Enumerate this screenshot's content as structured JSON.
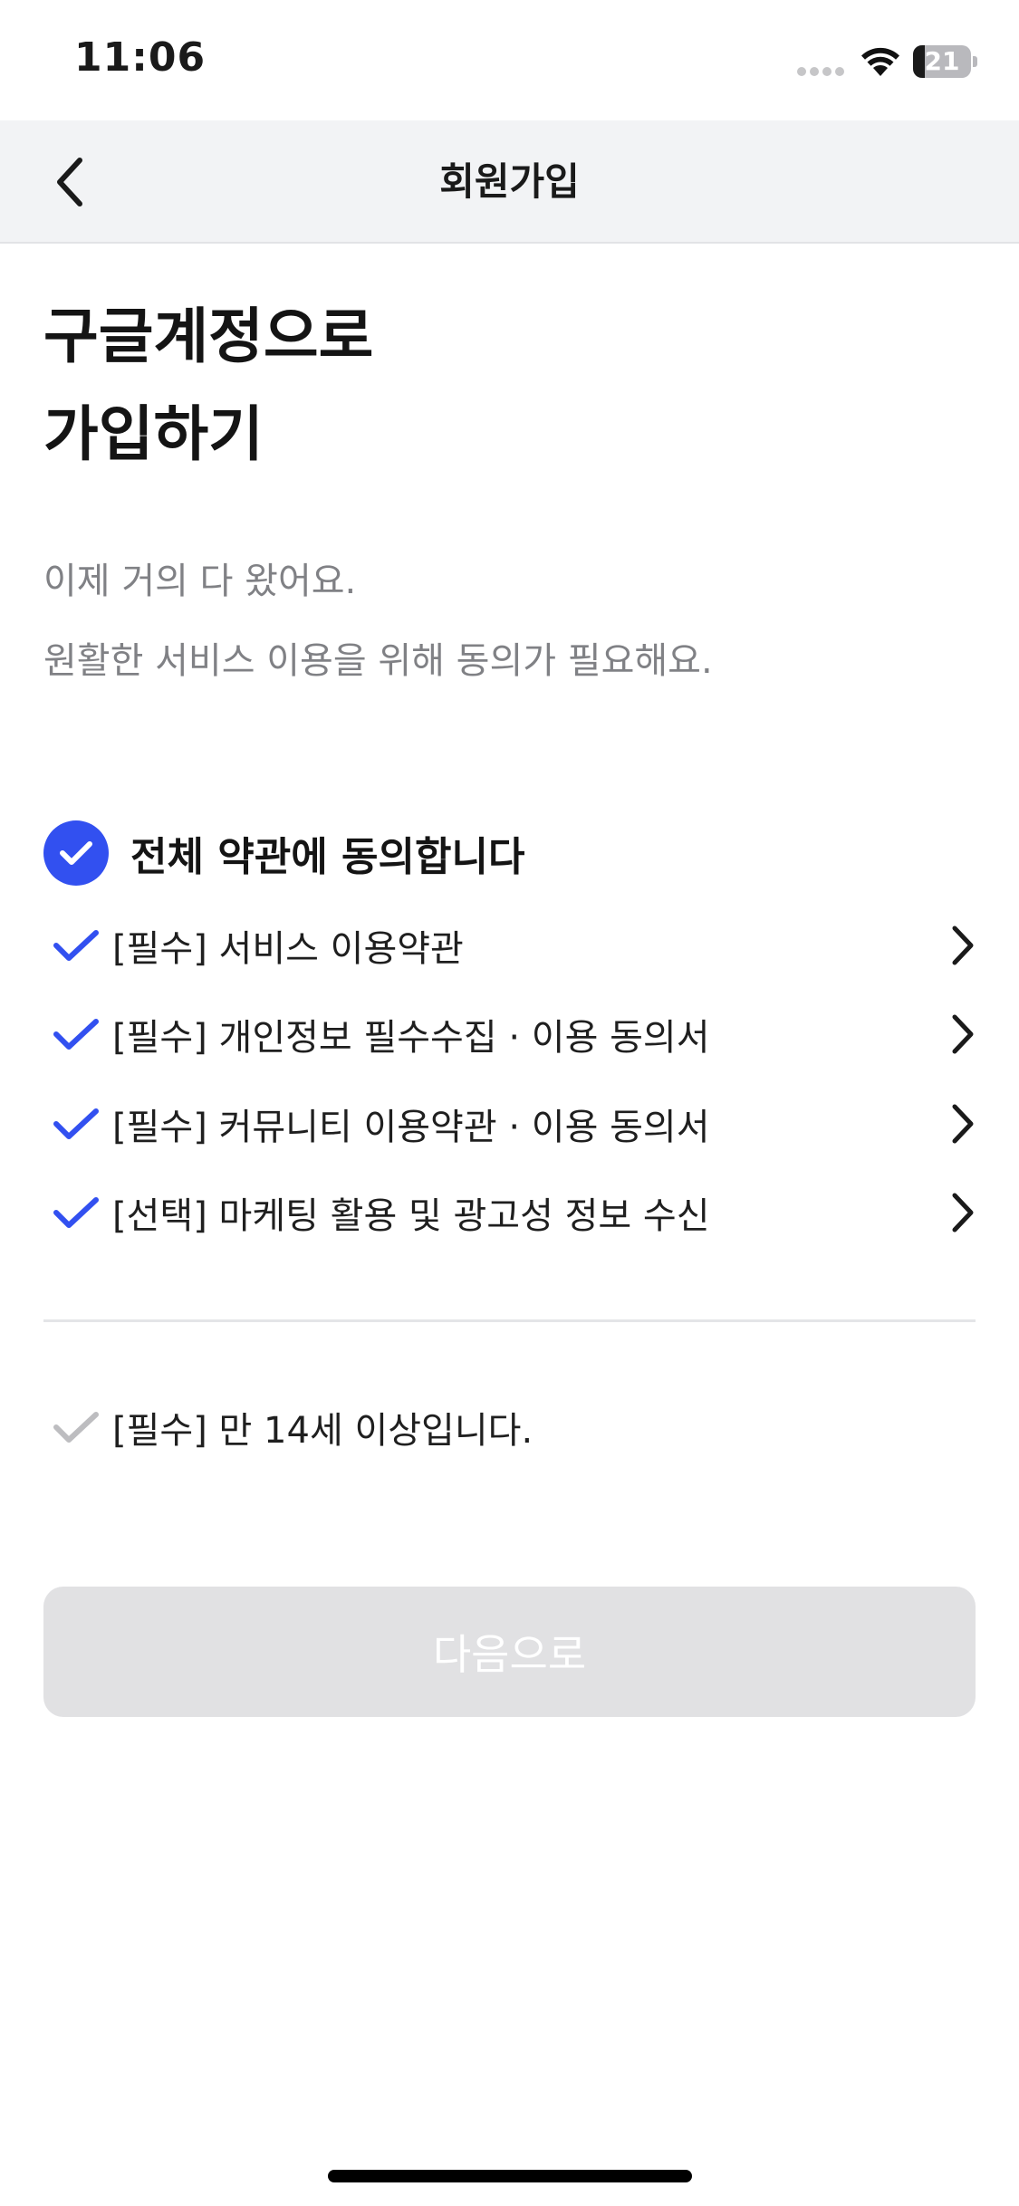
{
  "status_bar": {
    "time": "11:06",
    "battery_level": "21",
    "battery_fraction": 0.21,
    "icons": [
      "signal-dots-icon",
      "wifi-icon",
      "battery-icon"
    ]
  },
  "nav": {
    "title": "회원가입",
    "back_icon": "chevron-left-icon"
  },
  "headline": {
    "line1": "구글계정으로",
    "line2": "가입하기"
  },
  "subtext": {
    "line1": "이제 거의 다 왔어요.",
    "line2": "원활한 서비스 이용을 위해 동의가 필요해요."
  },
  "agreements": {
    "all_label": "전체 약관에 동의합니다",
    "all_checked": true,
    "items": [
      {
        "label": "[필수] 서비스 이용약관",
        "checked": true
      },
      {
        "label": "[필수] 개인정보 필수수집 · 이용 동의서",
        "checked": true
      },
      {
        "label": "[필수] 커뮤니티 이용약관 · 이용 동의서",
        "checked": true
      },
      {
        "label": "[선택] 마케팅 활용 및 광고성 정보 수신",
        "checked": true
      }
    ],
    "age": {
      "label": "[필수] 만 14세 이상입니다.",
      "checked": false
    }
  },
  "next_button": {
    "label": "다음으로",
    "enabled": false
  },
  "colors": {
    "accent": "#3250f0",
    "check_inactive": "#bdbdc0",
    "button_disabled": "#e1e1e3",
    "subtext": "#808185",
    "nav_background": "#f2f3f5"
  }
}
